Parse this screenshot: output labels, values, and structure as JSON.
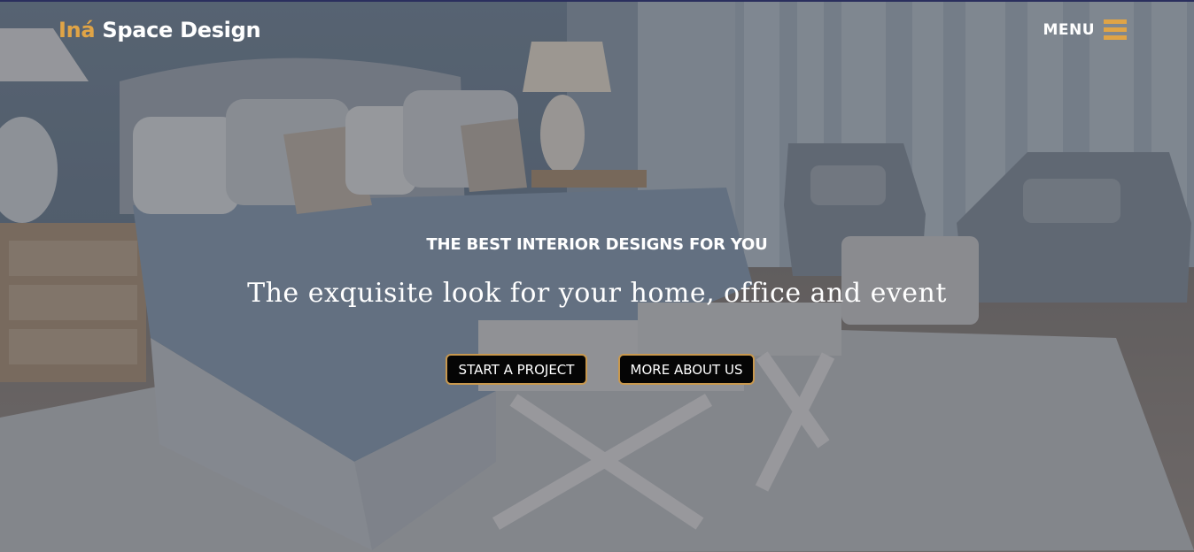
{
  "brand": {
    "accent_word": "Iná",
    "rest": "Space Design"
  },
  "nav": {
    "menu_label": "MENU",
    "menu_icon": "hamburger-icon"
  },
  "hero": {
    "kicker": "THE BEST INTERIOR DESIGNS FOR YOU",
    "headline": "The exquisite look for your home, office and event",
    "buttons": {
      "start": "START A PROJECT",
      "more": "MORE ABOUT US"
    }
  },
  "colors": {
    "accent": "#e0a446",
    "button_bg": "#050505",
    "button_border": "#c8984e",
    "text": "#ffffff"
  }
}
